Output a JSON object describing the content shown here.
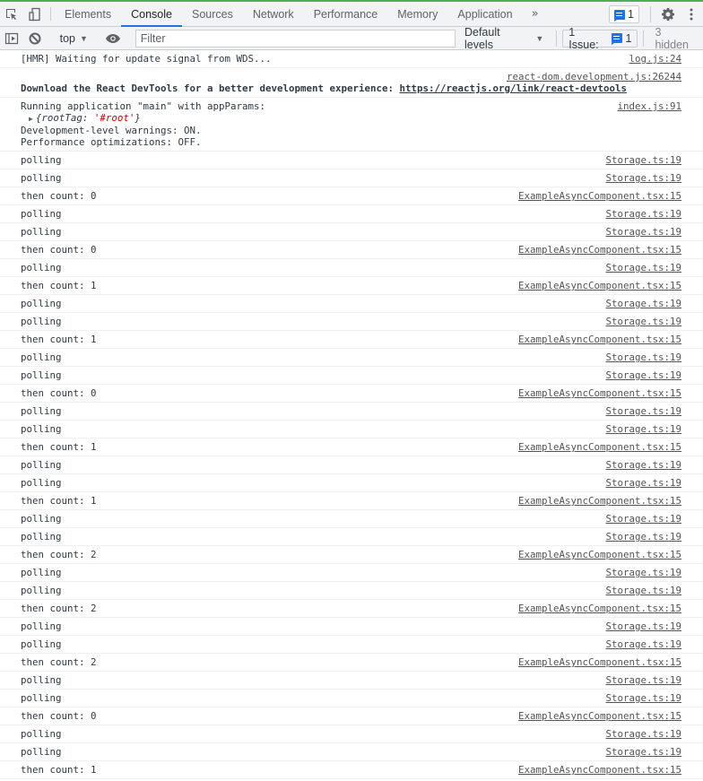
{
  "tabbar": {
    "tabs": [
      {
        "label": "Elements",
        "active": false
      },
      {
        "label": "Console",
        "active": true
      },
      {
        "label": "Sources",
        "active": false
      },
      {
        "label": "Network",
        "active": false
      },
      {
        "label": "Performance",
        "active": false
      },
      {
        "label": "Memory",
        "active": false
      },
      {
        "label": "Application",
        "active": false
      }
    ],
    "more_tabs_label": "»",
    "issues_count": "1",
    "accent_color": "#1a73e8"
  },
  "toolbar": {
    "context_label": "top",
    "filter_placeholder": "Filter",
    "filter_value": "",
    "levels_label": "Default levels",
    "issue_label": "1 Issue:",
    "issue_count": "1",
    "hidden_label": "3 hidden"
  },
  "console": {
    "hmr": {
      "text": "[HMR] Waiting for update signal from WDS...",
      "source": "log.js:24"
    },
    "devtools": {
      "source": "react-dom.development.js:26244",
      "text": "Download the React DevTools for a better development experience: ",
      "link": "https://reactjs.org/link/react-devtools"
    },
    "running": {
      "source": "index.js:91",
      "line1": "Running application \"main\" with appParams:",
      "obj_prefix": "{rootTag: ",
      "obj_value": "'#root'",
      "obj_suffix": "}",
      "line3": "Development-level warnings: ON.",
      "line4": "Performance optimizations: OFF."
    },
    "messages": [
      {
        "text": "polling",
        "source": "Storage.ts:19"
      },
      {
        "text": "polling",
        "source": "Storage.ts:19"
      },
      {
        "text": "then count: 0",
        "source": "ExampleAsyncComponent.tsx:15"
      },
      {
        "text": "polling",
        "source": "Storage.ts:19"
      },
      {
        "text": "polling",
        "source": "Storage.ts:19"
      },
      {
        "text": "then count: 0",
        "source": "ExampleAsyncComponent.tsx:15"
      },
      {
        "text": "polling",
        "source": "Storage.ts:19"
      },
      {
        "text": "then count: 1",
        "source": "ExampleAsyncComponent.tsx:15"
      },
      {
        "text": "polling",
        "source": "Storage.ts:19"
      },
      {
        "text": "polling",
        "source": "Storage.ts:19"
      },
      {
        "text": "then count: 1",
        "source": "ExampleAsyncComponent.tsx:15"
      },
      {
        "text": "polling",
        "source": "Storage.ts:19"
      },
      {
        "text": "polling",
        "source": "Storage.ts:19"
      },
      {
        "text": "then count: 0",
        "source": "ExampleAsyncComponent.tsx:15"
      },
      {
        "text": "polling",
        "source": "Storage.ts:19"
      },
      {
        "text": "polling",
        "source": "Storage.ts:19"
      },
      {
        "text": "then count: 1",
        "source": "ExampleAsyncComponent.tsx:15"
      },
      {
        "text": "polling",
        "source": "Storage.ts:19"
      },
      {
        "text": "polling",
        "source": "Storage.ts:19"
      },
      {
        "text": "then count: 1",
        "source": "ExampleAsyncComponent.tsx:15"
      },
      {
        "text": "polling",
        "source": "Storage.ts:19"
      },
      {
        "text": "polling",
        "source": "Storage.ts:19"
      },
      {
        "text": "then count: 2",
        "source": "ExampleAsyncComponent.tsx:15"
      },
      {
        "text": "polling",
        "source": "Storage.ts:19"
      },
      {
        "text": "polling",
        "source": "Storage.ts:19"
      },
      {
        "text": "then count: 2",
        "source": "ExampleAsyncComponent.tsx:15"
      },
      {
        "text": "polling",
        "source": "Storage.ts:19"
      },
      {
        "text": "polling",
        "source": "Storage.ts:19"
      },
      {
        "text": "then count: 2",
        "source": "ExampleAsyncComponent.tsx:15"
      },
      {
        "text": "polling",
        "source": "Storage.ts:19"
      },
      {
        "text": "polling",
        "source": "Storage.ts:19"
      },
      {
        "text": "then count: 0",
        "source": "ExampleAsyncComponent.tsx:15"
      },
      {
        "text": "polling",
        "source": "Storage.ts:19"
      },
      {
        "text": "polling",
        "source": "Storage.ts:19"
      },
      {
        "text": "then count: 1",
        "source": "ExampleAsyncComponent.tsx:15"
      }
    ]
  }
}
